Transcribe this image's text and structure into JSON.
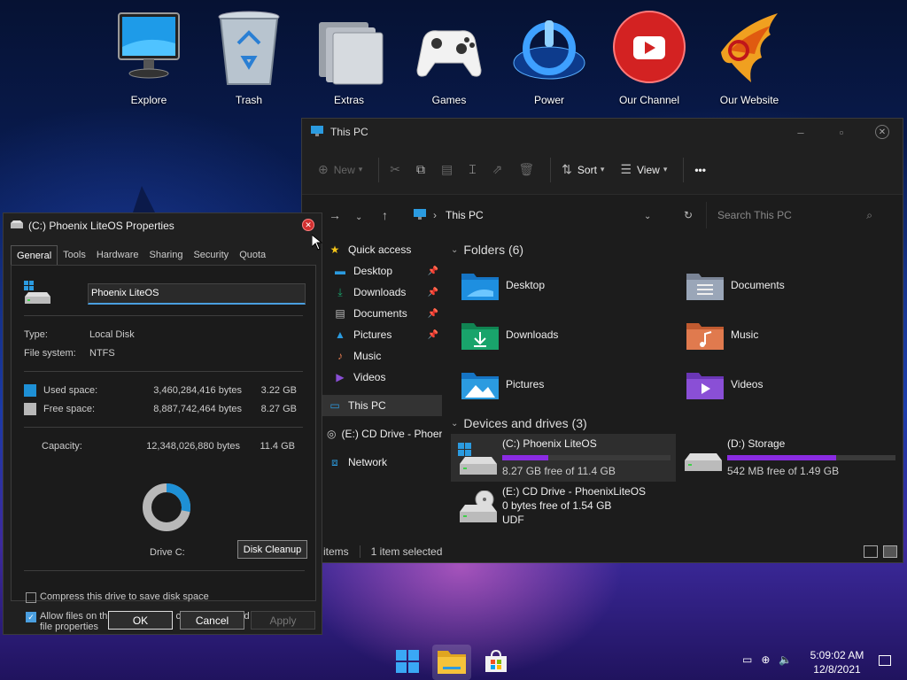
{
  "desktop": {
    "icons": [
      {
        "label": "Explore",
        "icon": "monitor-icon"
      },
      {
        "label": "Trash",
        "icon": "recycle-bin-icon"
      },
      {
        "label": "Extras",
        "icon": "folder-stack-icon"
      },
      {
        "label": "Games",
        "icon": "gamepad-icon"
      },
      {
        "label": "Power",
        "icon": "power-icon"
      },
      {
        "label": "Our Channel",
        "icon": "youtube-icon"
      },
      {
        "label": "Our Website",
        "icon": "phoenix-icon"
      }
    ]
  },
  "explorer": {
    "title": "This PC",
    "toolbar": {
      "new_label": "New",
      "sort_label": "Sort",
      "view_label": "View",
      "more_label": "•••"
    },
    "address": {
      "path": "This PC",
      "search_placeholder": "Search This PC"
    },
    "nav": {
      "quick_access": "Quick access",
      "items": [
        {
          "label": "Desktop",
          "icon": "desktop-icon",
          "pinned": true
        },
        {
          "label": "Downloads",
          "icon": "download-icon",
          "pinned": true
        },
        {
          "label": "Documents",
          "icon": "document-icon",
          "pinned": true
        },
        {
          "label": "Pictures",
          "icon": "picture-icon",
          "pinned": true
        },
        {
          "label": "Music",
          "icon": "music-icon",
          "pinned": false
        },
        {
          "label": "Videos",
          "icon": "video-icon",
          "pinned": false
        }
      ],
      "this_pc": "This PC",
      "cd_drive": "(E:) CD Drive - Phoer",
      "network": "Network"
    },
    "folders_header": "Folders (6)",
    "folders": [
      {
        "label": "Desktop",
        "color": "#1e8fe0",
        "icon": "desktop-folder-icon"
      },
      {
        "label": "Documents",
        "color": "#9aa6b8",
        "icon": "documents-folder-icon"
      },
      {
        "label": "Downloads",
        "color": "#19a46b",
        "icon": "downloads-folder-icon"
      },
      {
        "label": "Music",
        "color": "#e07a4e",
        "icon": "music-folder-icon"
      },
      {
        "label": "Pictures",
        "color": "#2b9be0",
        "icon": "pictures-folder-icon"
      },
      {
        "label": "Videos",
        "color": "#8a4fd6",
        "icon": "videos-folder-icon"
      }
    ],
    "drives_header": "Devices and drives (3)",
    "drives": [
      {
        "name": "(C:) Phoenix LiteOS",
        "free": "8.27 GB free of 11.4 GB",
        "used_fraction": 0.275,
        "selected": true,
        "icon": "windows-drive-icon"
      },
      {
        "name": "(D:) Storage",
        "free": "542 MB free of 1.49 GB",
        "used_fraction": 0.645,
        "selected": false,
        "icon": "hard-drive-icon"
      },
      {
        "name": "(E:) CD Drive - PhoenixLiteOS",
        "free": "0 bytes free of 1.54 GB",
        "fs": "UDF",
        "selected": false,
        "icon": "cd-drive-icon"
      }
    ],
    "status": {
      "items": "items",
      "selected": "1 item selected"
    }
  },
  "properties": {
    "title": "(C:) Phoenix LiteOS Properties",
    "tabs": [
      "General",
      "Tools",
      "Hardware",
      "Sharing",
      "Security",
      "Quota"
    ],
    "drive_name": "Phoenix LiteOS",
    "type_label": "Type:",
    "type_value": "Local Disk",
    "fs_label": "File system:",
    "fs_value": "NTFS",
    "used_label": "Used space:",
    "used_bytes": "3,460,284,416 bytes",
    "used_gb": "3.22 GB",
    "free_label": "Free space:",
    "free_bytes": "8,887,742,464 bytes",
    "free_gb": "8.27 GB",
    "capacity_label": "Capacity:",
    "capacity_bytes": "12,348,026,880 bytes",
    "capacity_gb": "11.4 GB",
    "used_fraction": 0.28,
    "drive_label": "Drive C:",
    "cleanup": "Disk Cleanup",
    "compress": "Compress this drive to save disk space",
    "index": "Allow files on this drive to have contents indexed in addition to file properties",
    "ok": "OK",
    "cancel": "Cancel",
    "apply": "Apply",
    "colors": {
      "used": "#1e90d6",
      "free": "#b8b8b8"
    }
  },
  "taskbar": {
    "apps": [
      "windows-start-icon",
      "file-explorer-icon",
      "store-icon"
    ],
    "time": "5:09:02 AM",
    "date": "12/8/2021"
  }
}
